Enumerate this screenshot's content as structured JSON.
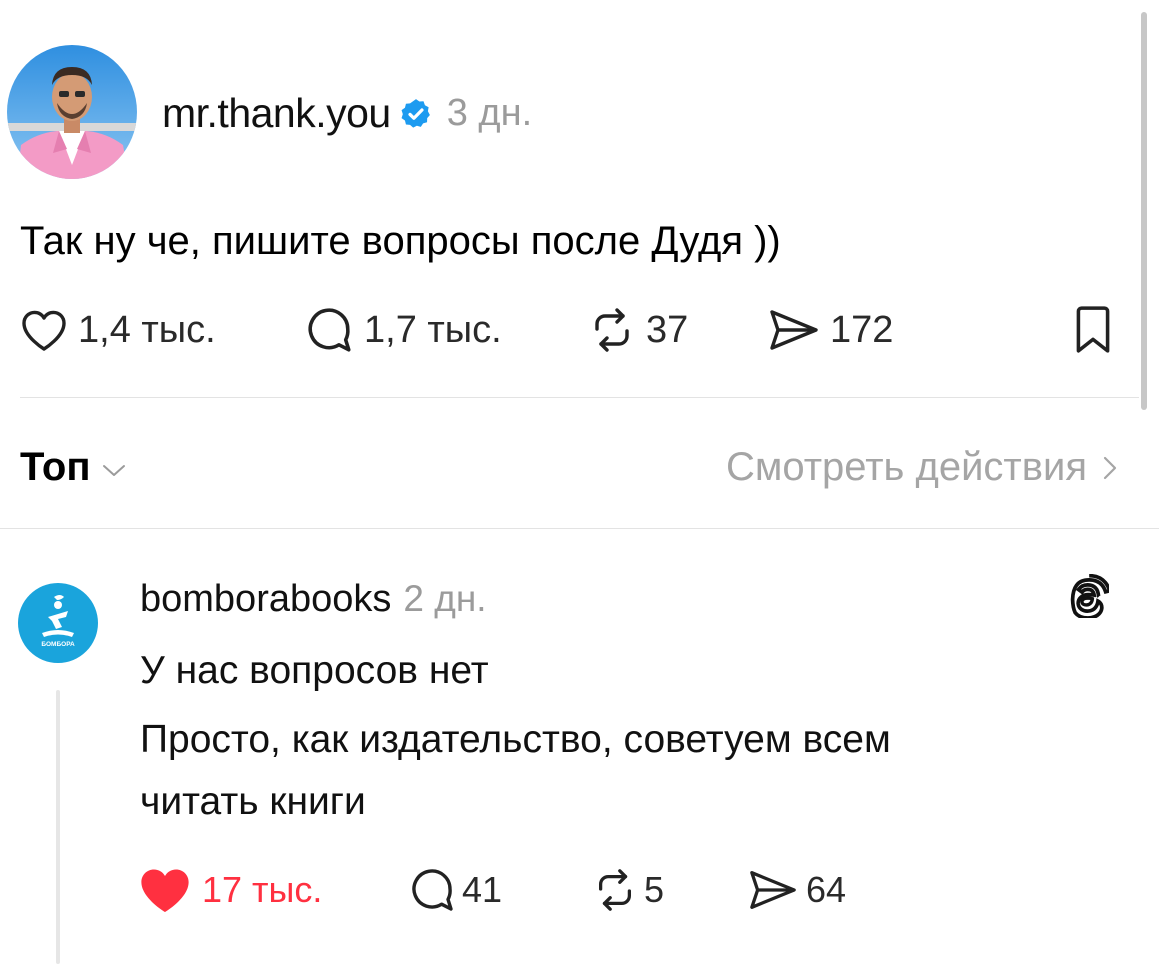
{
  "post": {
    "author": "mr.thank.you",
    "time": "3 дн.",
    "text": "Так ну че, пишите вопросы после Дудя ))",
    "actions": {
      "likes": "1,4 тыс.",
      "comments": "1,7 тыс.",
      "reposts": "37",
      "shares": "172"
    }
  },
  "replies_header": {
    "sort_label": "Топ",
    "view_activity": "Смотреть действия"
  },
  "reply": {
    "author": "bomborabooks",
    "time": "2 дн.",
    "avatar_text": "БОМБОРА",
    "lines": [
      "У нас вопросов нет",
      "Просто, как издательство, советуем всем",
      "читать книги"
    ],
    "actions": {
      "likes": "17 тыс.",
      "comments": "41",
      "reposts": "5",
      "shares": "64"
    },
    "liked": true
  },
  "colors": {
    "verified": "#1d9bf0",
    "liked": "#ff3040",
    "muted": "#9b9b9b",
    "reply_avatar": "#1aa4dc"
  }
}
